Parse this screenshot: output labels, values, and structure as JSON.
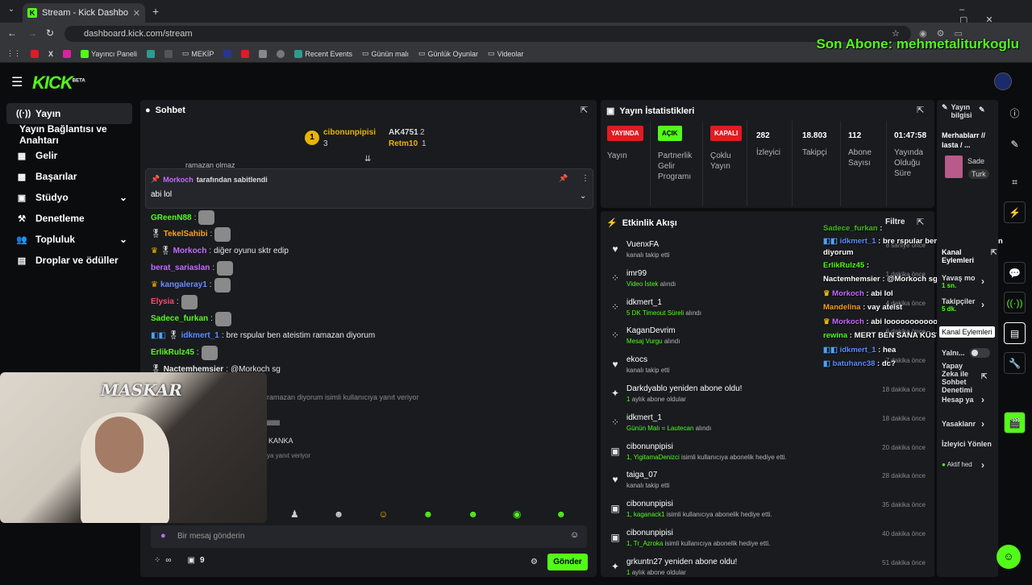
{
  "browser": {
    "tab_title": "Stream - Kick Dashboard",
    "url": "dashboard.kick.com/stream",
    "bookmarks": [
      "Yayıncı Paneli",
      "MEKİP",
      "Recent Events",
      "Günün malı",
      "Günlük Oyunlar",
      "Videolar"
    ]
  },
  "overlay": {
    "text": "Son Abone: mehmetaliturkoglu",
    "cam_label": "MASKAR"
  },
  "app": {
    "logo": "KICK",
    "logo_sup": "BETA"
  },
  "sidebar": {
    "items": [
      {
        "icon": "((·))",
        "label": "Yayın"
      },
      {
        "icon": "",
        "label": "Yayın Bağlantısı ve Anahtarı"
      },
      {
        "icon": "▦",
        "label": "Gelir"
      },
      {
        "icon": "▩",
        "label": "Başarılar"
      },
      {
        "icon": "▣",
        "label": "Stüdyo"
      },
      {
        "icon": "⚒",
        "label": "Denetleme"
      },
      {
        "icon": "👥",
        "label": "Topluluk"
      },
      {
        "icon": "▤",
        "label": "Droplar ve ödüller"
      }
    ]
  },
  "chat": {
    "title": "Sohbet",
    "top_gifter_1": {
      "name": "cibonunpipisi",
      "rank": "1",
      "count": "3"
    },
    "top_gifter_2a": {
      "name": "AK4751",
      "count": "2"
    },
    "top_gifter_2b": {
      "name": "Retm10",
      "count": "1"
    },
    "scrolled_text": "ramazan olmaz",
    "pinned": {
      "by": "Morkoch",
      "by_suffix": "tarafından sabitlendi",
      "text": "abi lol"
    },
    "messages": [
      {
        "user": "GReenN88",
        "color": "#53fc18",
        "text": "",
        "emote": true
      },
      {
        "user": "TekelSahibi",
        "color": "#ff9f1a",
        "text": "",
        "emote": true
      },
      {
        "user": "Morkoch",
        "color": "#c46bff",
        "text": "diğer oyunu sktr edip",
        "emote": false
      },
      {
        "user": "berat_sariaslan",
        "color": "#c46bff",
        "text": "",
        "emote": true
      },
      {
        "user": "kangaleray1",
        "color": "#6b8bff",
        "text": "",
        "emote": true
      },
      {
        "user": "Elysia",
        "color": "#ff4b6b",
        "text": "",
        "emote": true
      },
      {
        "user": "Sadece_furkan",
        "color": "#53fc18",
        "text": "",
        "emote": true
      },
      {
        "user": "idkmert_1",
        "color": "#5b8cff",
        "text": "bre rspular ben ateistim ramazan diyorum",
        "emote": false
      },
      {
        "user": "ErlikRulz45",
        "color": "#53fc18",
        "text": "",
        "emote": true
      },
      {
        "user": "Nactemhemsier",
        "color": "#e8e8e8",
        "text": "@Morkoch sg",
        "emote": false
      }
    ],
    "partial_lines": [
      "ramazan diyorum isimli kullanıcıya yanıt veriyor",
      "llllllll",
      "KANKA",
      "ya yanıt veriyor"
    ],
    "input_placeholder": "Bir mesaj gönderin",
    "points": "∞",
    "gift_count": "9",
    "send_label": "Gönder"
  },
  "stats": {
    "title": "Yayın İstatistikleri",
    "cols": [
      {
        "badge": "YAYINDA",
        "badge_color": "#e01b24",
        "label": "Yayın"
      },
      {
        "badge": "AÇIK",
        "badge_color": "#53fc18",
        "label": "Partnerlik Gelir Programı"
      },
      {
        "badge": "KAPALI",
        "badge_color": "#e01b24",
        "label": "Çoklu Yayın"
      },
      {
        "value": "282",
        "label": "İzleyici"
      },
      {
        "value": "18.803",
        "label": "Takipçi"
      },
      {
        "value": "112",
        "label": "Abone Sayısı"
      },
      {
        "value": "01:47:58",
        "label": "Yayında Olduğu Süre"
      }
    ]
  },
  "activity": {
    "title": "Etkinlik Akışı",
    "filter_label": "Filtre",
    "items": [
      {
        "icon": "heart-icon",
        "glyph": "♥",
        "name": "VuenxFA",
        "sub": "kanalı takip etti",
        "sub_green": "",
        "time": "8 saniye önce"
      },
      {
        "icon": "points-icon",
        "glyph": "⁘",
        "name": "imr99",
        "sub": "alındı",
        "sub_green": "Video İstek",
        "time": "1 dakika önce"
      },
      {
        "icon": "points-icon",
        "glyph": "⁘",
        "name": "idkmert_1",
        "sub": "alındı",
        "sub_green": "5 DK Timeout Süreli",
        "time": "4 dakika önce"
      },
      {
        "icon": "points-icon",
        "glyph": "⁘",
        "name": "KaganDevrim",
        "sub": "alındı",
        "sub_green": "Mesaj Vurgu",
        "time": "6 dakika önce"
      },
      {
        "icon": "heart-icon",
        "glyph": "♥",
        "name": "ekocs",
        "sub": "kanalı takip etti",
        "sub_green": "",
        "time": "7 dakika önce"
      },
      {
        "icon": "star-icon",
        "glyph": "✦",
        "name": "Darkdyablo yeniden abone oldu!",
        "sub": "aylık abone oldular",
        "sub_green": "1",
        "time": "18 dakika önce"
      },
      {
        "icon": "points-icon",
        "glyph": "⁘",
        "name": "idkmert_1",
        "sub": "alındı",
        "sub_green": "Günün Malı = Lautecan",
        "time": "18 dakika önce"
      },
      {
        "icon": "gift-icon",
        "glyph": "▣",
        "name": "cibonunpipisi",
        "sub": "isimli kullanıcıya abonelik hediye etti.",
        "sub_green": "1, YigitamaDenizci",
        "time": "20 dakika önce"
      },
      {
        "icon": "heart-icon",
        "glyph": "♥",
        "name": "taiga_07",
        "sub": "kanalı takip etti",
        "sub_green": "",
        "time": "28 dakika önce"
      },
      {
        "icon": "gift-icon",
        "glyph": "▣",
        "name": "cibonunpipisi",
        "sub": "isimli kullanıcıya abonelik hediye etti.",
        "sub_green": "1, kaganack1",
        "time": "35 dakika önce"
      },
      {
        "icon": "gift-icon",
        "glyph": "▣",
        "name": "cibonunpipisi",
        "sub": "isimli kullanıcıya abonelik hediye etti.",
        "sub_green": "1, Tr_Azroka",
        "time": "40 dakika önce"
      },
      {
        "icon": "star-icon",
        "glyph": "✦",
        "name": "grkuntn27 yeniden abone oldu!",
        "sub": "aylık abone oldular",
        "sub_green": "1",
        "time": "51 dakika önce"
      }
    ]
  },
  "chat_overlay": [
    {
      "user": "Sadece_furkan",
      "color": "#53fc18",
      "text": ""
    },
    {
      "user": "idkmert_1",
      "color": "#5b8cff",
      "text": "bre rspular ben ateistim ramazan diyorum"
    },
    {
      "user": "ErlikRulz45",
      "color": "#53fc18",
      "text": ""
    },
    {
      "user": "Nactemhemsier",
      "color": "#ffffff",
      "text": "@Morkoch sg"
    },
    {
      "user": "Morkoch",
      "color": "#c46bff",
      "text": "abi lol"
    },
    {
      "user": "Mandelina",
      "color": "#ff9f1a",
      "text": "vay ateist"
    },
    {
      "user": "Morkoch",
      "color": "#c46bff",
      "text": "abi looooooooooolllllllll"
    },
    {
      "user": "rewina",
      "color": "#53fc18",
      "text": "MERT BEN SANA KÜSTÜM KANKA"
    },
    {
      "user": "idkmert_1",
      "color": "#5b8cff",
      "text": "hea"
    },
    {
      "user": "batuhanc38",
      "color": "#5b8cff",
      "text": "dc?"
    }
  ],
  "right_panel": {
    "info_title": "Yayın bilgisi",
    "stream_title": "Merhablarr // lasta / ...",
    "category_a": "Sade",
    "category_b": "Turk",
    "channel_actions": "Kanal Eylemleri",
    "rows": [
      "Yavaş mo",
      "Takipçiler",
      "Yalnı...",
      "Yapay Zeka ile Sohbet Denetimi",
      "Hesap ya",
      "Yasaklanr",
      "İzleyici Yönlen",
      "Aktif hed"
    ],
    "slow_sub": "1 sn.",
    "followers_sub": "5 dk.",
    "tooltip": "Kanal Eylemleri"
  }
}
